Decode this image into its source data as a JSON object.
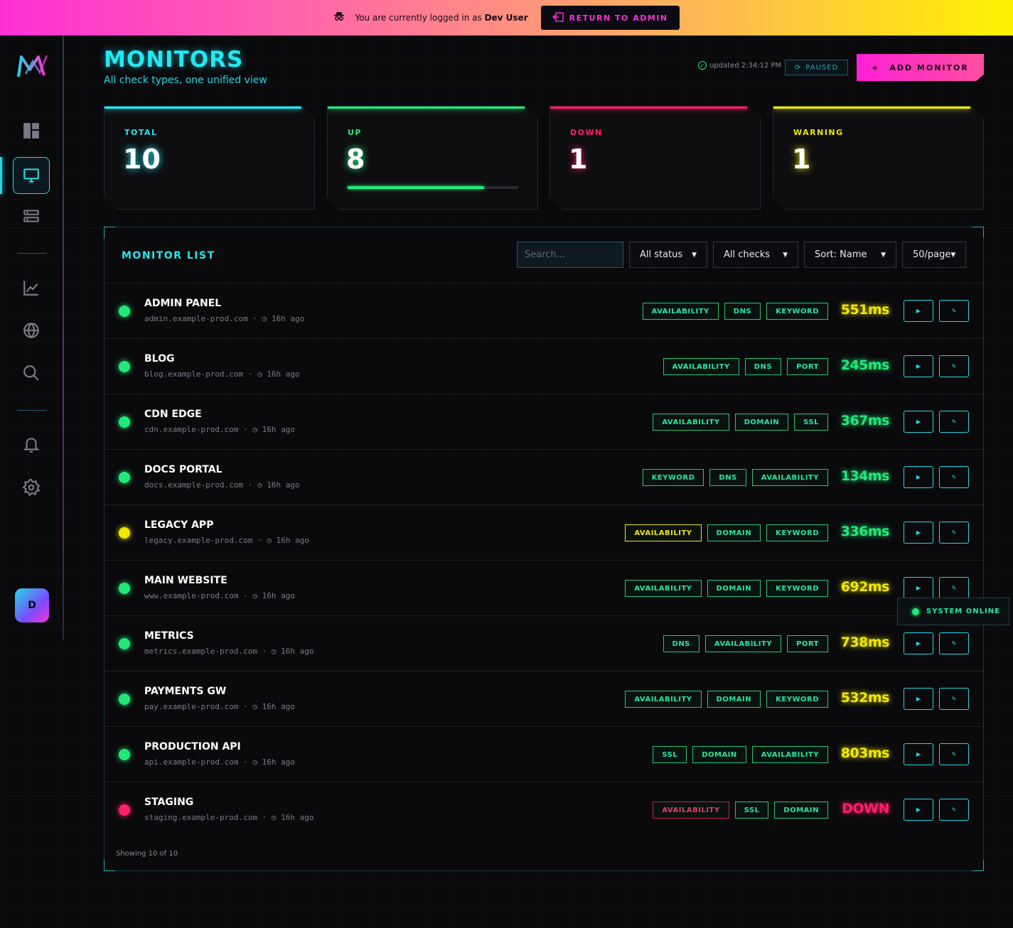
{
  "banner": {
    "message_prefix": "You are currently logged in as",
    "user": "Dev User",
    "return_label": "RETURN TO ADMIN"
  },
  "header": {
    "title": "MONITORS",
    "subtitle": "All check types, one unified view",
    "updated": "updated 2:34:12 PM",
    "paused_label": "PAUSED",
    "add_label": "ADD MONITOR"
  },
  "stats": [
    {
      "label": "TOTAL",
      "value": "10",
      "color": "#22e8f0"
    },
    {
      "label": "UP",
      "value": "8",
      "color": "#22e87a",
      "progress_fraction": 0.8
    },
    {
      "label": "DOWN",
      "value": "1",
      "color": "#ff1f6a"
    },
    {
      "label": "WARNING",
      "value": "1",
      "color": "#f0e800"
    }
  ],
  "panel": {
    "title": "MONITOR LIST",
    "search_placeholder": "Search...",
    "filters": [
      "All status",
      "All checks",
      "Sort: Name",
      "50/page"
    ],
    "footer": "Showing 10 of 10"
  },
  "monitors": [
    {
      "name": "ADMIN PANEL",
      "host": "admin.example-prod.com",
      "ago": "16h ago",
      "status": "up",
      "tags": [
        {
          "t": "AVAILABILITY",
          "s": "ok"
        },
        {
          "t": "DNS",
          "s": "ok"
        },
        {
          "t": "KEYWORD",
          "s": "ok"
        }
      ],
      "latency": "551ms",
      "latency_color": "#f0e800"
    },
    {
      "name": "BLOG",
      "host": "blog.example-prod.com",
      "ago": "16h ago",
      "status": "up",
      "tags": [
        {
          "t": "AVAILABILITY",
          "s": "ok"
        },
        {
          "t": "DNS",
          "s": "ok"
        },
        {
          "t": "PORT",
          "s": "ok"
        }
      ],
      "latency": "245ms",
      "latency_color": "#22e87a"
    },
    {
      "name": "CDN EDGE",
      "host": "cdn.example-prod.com",
      "ago": "16h ago",
      "status": "up",
      "tags": [
        {
          "t": "AVAILABILITY",
          "s": "ok"
        },
        {
          "t": "DOMAIN",
          "s": "ok"
        },
        {
          "t": "SSL",
          "s": "ok"
        }
      ],
      "latency": "367ms",
      "latency_color": "#22e87a"
    },
    {
      "name": "DOCS PORTAL",
      "host": "docs.example-prod.com",
      "ago": "16h ago",
      "status": "up",
      "tags": [
        {
          "t": "KEYWORD",
          "s": "ok"
        },
        {
          "t": "DNS",
          "s": "ok"
        },
        {
          "t": "AVAILABILITY",
          "s": "ok"
        }
      ],
      "latency": "134ms",
      "latency_color": "#22e87a"
    },
    {
      "name": "LEGACY APP",
      "host": "legacy.example-prod.com",
      "ago": "16h ago",
      "status": "warning",
      "tags": [
        {
          "t": "AVAILABILITY",
          "s": "warn"
        },
        {
          "t": "DOMAIN",
          "s": "ok"
        },
        {
          "t": "KEYWORD",
          "s": "ok"
        }
      ],
      "latency": "336ms",
      "latency_color": "#22e87a"
    },
    {
      "name": "MAIN WEBSITE",
      "host": "www.example-prod.com",
      "ago": "16h ago",
      "status": "up",
      "tags": [
        {
          "t": "AVAILABILITY",
          "s": "ok"
        },
        {
          "t": "DOMAIN",
          "s": "ok"
        },
        {
          "t": "KEYWORD",
          "s": "ok"
        }
      ],
      "latency": "692ms",
      "latency_color": "#f0e800"
    },
    {
      "name": "METRICS",
      "host": "metrics.example-prod.com",
      "ago": "16h ago",
      "status": "up",
      "tags": [
        {
          "t": "DNS",
          "s": "ok"
        },
        {
          "t": "AVAILABILITY",
          "s": "ok"
        },
        {
          "t": "PORT",
          "s": "ok"
        }
      ],
      "latency": "738ms",
      "latency_color": "#f0e800"
    },
    {
      "name": "PAYMENTS GW",
      "host": "pay.example-prod.com",
      "ago": "16h ago",
      "status": "up",
      "tags": [
        {
          "t": "AVAILABILITY",
          "s": "ok"
        },
        {
          "t": "DOMAIN",
          "s": "ok"
        },
        {
          "t": "KEYWORD",
          "s": "ok"
        }
      ],
      "latency": "532ms",
      "latency_color": "#f0e800"
    },
    {
      "name": "PRODUCTION API",
      "host": "api.example-prod.com",
      "ago": "16h ago",
      "status": "up",
      "tags": [
        {
          "t": "SSL",
          "s": "ok"
        },
        {
          "t": "DOMAIN",
          "s": "ok"
        },
        {
          "t": "AVAILABILITY",
          "s": "ok"
        }
      ],
      "latency": "803ms",
      "latency_color": "#f0e800"
    },
    {
      "name": "STAGING",
      "host": "staging.example-prod.com",
      "ago": "16h ago",
      "status": "down",
      "tags": [
        {
          "t": "AVAILABILITY",
          "s": "down"
        },
        {
          "t": "SSL",
          "s": "ok"
        },
        {
          "t": "DOMAIN",
          "s": "ok"
        }
      ],
      "latency": "DOWN",
      "latency_color": "#ff1f6a"
    }
  ],
  "status_colors": {
    "up": "#22e87a",
    "warning": "#f0e800",
    "down": "#ff1f6a"
  },
  "system_status": "SYSTEM ONLINE",
  "user_initial": "D"
}
